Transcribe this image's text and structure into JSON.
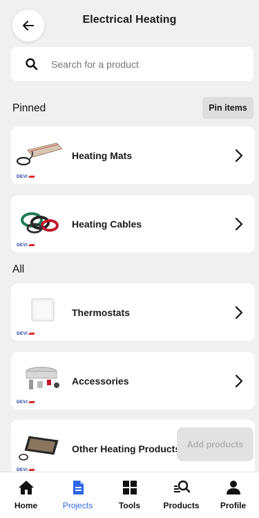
{
  "header": {
    "title": "Electrical Heating"
  },
  "search": {
    "placeholder": "Search for a product"
  },
  "pinned": {
    "section_label": "Pinned",
    "pin_button": "Pin items",
    "items": [
      {
        "label": "Heating Mats",
        "brand": "DEVI"
      },
      {
        "label": "Heating Cables",
        "brand": "DEVI"
      }
    ]
  },
  "all": {
    "section_label": "All",
    "items": [
      {
        "label": "Thermostats",
        "brand": "DEVI"
      },
      {
        "label": "Accessories",
        "brand": "DEVI"
      },
      {
        "label": "Other Heating Products",
        "brand": "DEVI"
      }
    ]
  },
  "add_button": "Add products",
  "bottom_nav": {
    "items": [
      {
        "label": "Home",
        "icon": "home-icon"
      },
      {
        "label": "Projects",
        "icon": "document-icon",
        "active": true
      },
      {
        "label": "Tools",
        "icon": "grid-icon"
      },
      {
        "label": "Products",
        "icon": "product-search-icon"
      },
      {
        "label": "Profile",
        "icon": "person-icon"
      }
    ]
  },
  "colors": {
    "accent": "#2e66e6",
    "brand_blue": "#1f3f99",
    "brand_red": "#d62828",
    "background": "#f0f0f0"
  }
}
